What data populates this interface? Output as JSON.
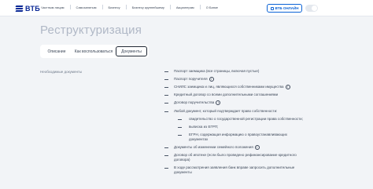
{
  "header": {
    "logo": "ВТБ",
    "nav": [
      "Частным лицам",
      "Самозанятым",
      "Бизнесу",
      "Бизнесу крупнейшему",
      "Акционерам",
      "О Банке"
    ],
    "login": "ВТБ ОНЛАЙН"
  },
  "page": {
    "title": "Реструктуризация",
    "tabs": [
      {
        "label": "Описание",
        "active": false
      },
      {
        "label": "Как воспользоваться",
        "active": false
      },
      {
        "label": "Документы",
        "active": true
      }
    ],
    "left_label": "Необходимые документы",
    "documents": [
      {
        "text": "Паспорт заемщика (все страницы, включая пустые)",
        "level": 0,
        "info": false
      },
      {
        "text": "Паспорт поручителя",
        "level": 0,
        "info": true
      },
      {
        "text": "СНИЛС заемщика и лиц, являющихся собственниками имущества",
        "level": 0,
        "info": true
      },
      {
        "text": "Кредитный договор со всеми дополнительными соглашениями",
        "level": 0,
        "info": false
      },
      {
        "text": "Договор поручительства",
        "level": 0,
        "info": true
      },
      {
        "text": "Любой документ, который подтверждает право собственности:",
        "level": 0,
        "info": false
      },
      {
        "text": "свидетельство о государственной регистрации права собственности;",
        "level": 1,
        "info": false
      },
      {
        "text": "выписка из ЕГРП;",
        "level": 1,
        "info": false
      },
      {
        "text": "ЕГРН, содержащая информацию о правоустанавливающих документах",
        "level": 1,
        "info": false
      },
      {
        "text": "Документы об изменении семейного положения",
        "level": 0,
        "info": true
      },
      {
        "text": "Договор об ипотеке (если было проведено рефинансирование кредитного договора)",
        "level": 0,
        "info": false
      },
      {
        "text": "В ходе рассмотрения заявления банк вправе запросить дополнительные документы",
        "level": 0,
        "info": false
      }
    ]
  },
  "colors": {
    "brand": "#0a2896",
    "accent": "#0a62d6",
    "background": "#f2f4f7"
  }
}
